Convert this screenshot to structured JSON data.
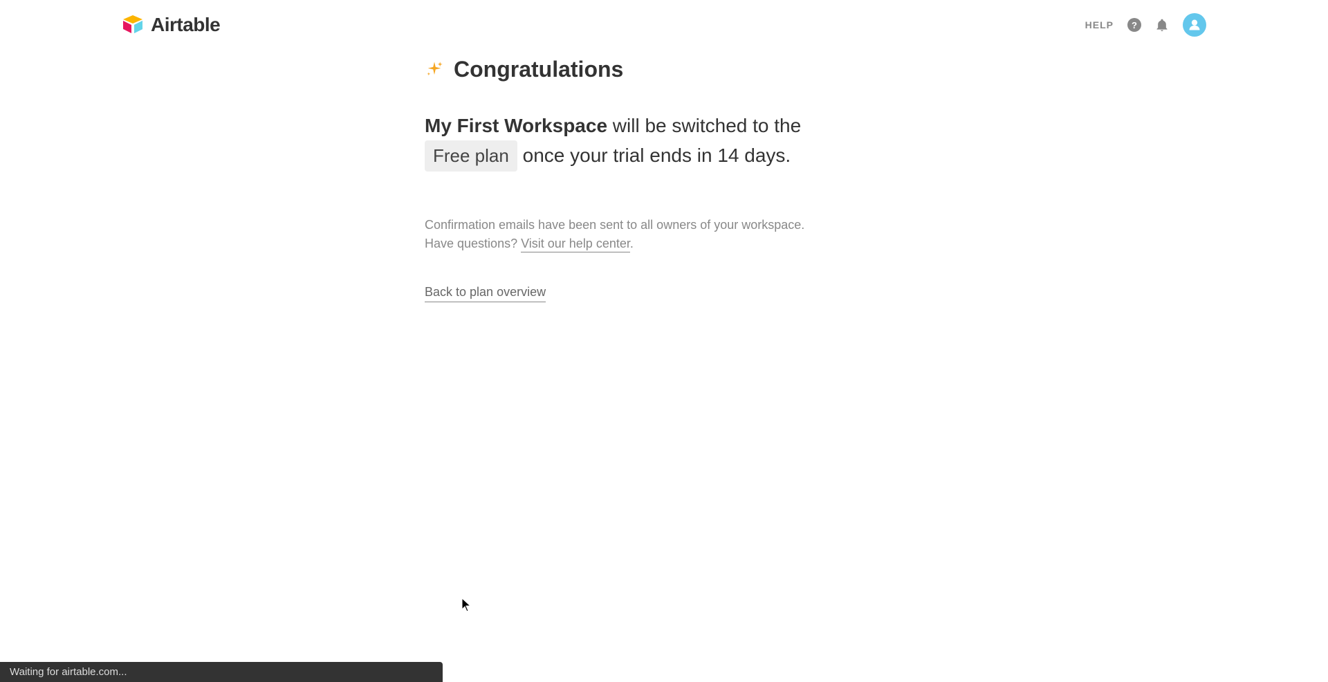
{
  "header": {
    "logo_text": "Airtable",
    "help_label": "HELP"
  },
  "content": {
    "title": "Congratulations",
    "workspace_name": "My First Workspace",
    "message_part1": " will be switched to the ",
    "plan_name": "Free plan",
    "message_part2": " once your trial ends in 14 days.",
    "confirmation_line1": "Confirmation emails have been sent to all owners of your workspace.",
    "confirmation_line2_prefix": "Have questions? ",
    "help_link_text": "Visit our help center",
    "confirmation_line2_suffix": ".",
    "back_link": "Back to plan overview"
  },
  "status": {
    "text": "Waiting for airtable.com..."
  }
}
